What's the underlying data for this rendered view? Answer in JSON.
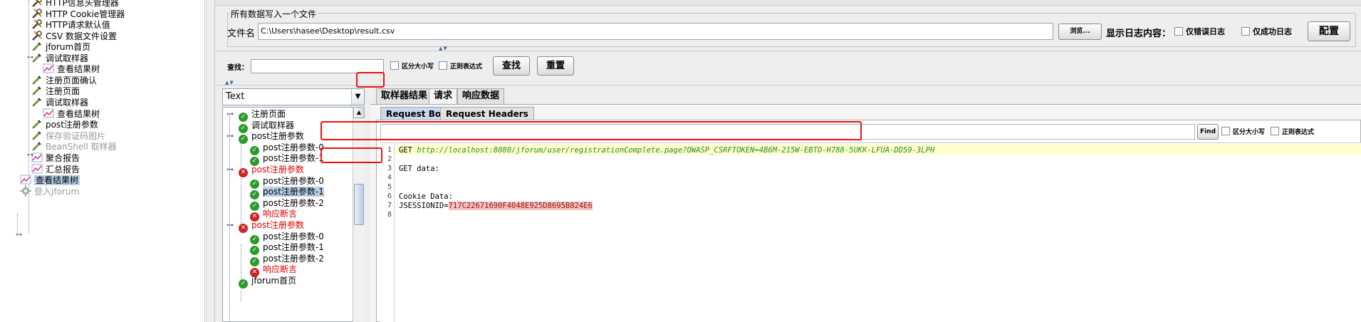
{
  "left_tree": {
    "items": [
      {
        "label": "HTTP信息头管理器",
        "icon": "wrench-icon",
        "disabled": false,
        "selected": false
      },
      {
        "label": "HTTP Cookie管理器",
        "icon": "wrench-icon",
        "disabled": false,
        "selected": false
      },
      {
        "label": "HTTP请求默认值",
        "icon": "wrench-icon",
        "disabled": false,
        "selected": false
      },
      {
        "label": "CSV 数据文件设置",
        "icon": "wrench-icon",
        "disabled": false,
        "selected": false
      },
      {
        "label": "jforum首页",
        "icon": "pipette-icon",
        "disabled": false,
        "selected": false
      },
      {
        "label": "调试取样器",
        "icon": "pipette-icon",
        "disabled": false,
        "selected": false
      },
      {
        "label": "查看结果树",
        "icon": "graph-icon",
        "disabled": false,
        "selected": false
      },
      {
        "label": "注册页面确认",
        "icon": "pipette-icon",
        "disabled": false,
        "selected": false
      },
      {
        "label": "注册页面",
        "icon": "pipette-icon",
        "disabled": false,
        "selected": false
      },
      {
        "label": "调试取样器",
        "icon": "pipette-icon",
        "disabled": false,
        "selected": false
      },
      {
        "label": "查看结果树",
        "icon": "graph-icon",
        "disabled": false,
        "selected": false
      },
      {
        "label": "post注册参数",
        "icon": "pipette-icon",
        "disabled": false,
        "selected": false
      },
      {
        "label": "保存验证码图片",
        "icon": "pipette-icon",
        "disabled": true,
        "selected": false
      },
      {
        "label": "BeanShell 取样器",
        "icon": "pipette-icon",
        "disabled": true,
        "selected": false
      },
      {
        "label": "聚合报告",
        "icon": "graph-icon",
        "disabled": false,
        "selected": false
      },
      {
        "label": "汇总报告",
        "icon": "graph-icon",
        "disabled": false,
        "selected": false
      },
      {
        "label": "查看结果树",
        "icon": "graph-icon",
        "disabled": false,
        "selected": true
      },
      {
        "label": "登入jforum",
        "icon": "gear-icon",
        "disabled": true,
        "selected": false
      }
    ]
  },
  "file_section": {
    "legend": "所有数据写入一个文件",
    "filename_label": "文件名",
    "filename_value": "C:\\Users\\hasee\\Desktop\\result.csv",
    "browse_button": "浏览...",
    "log_label": "显示日志内容：",
    "errors_only": "仅错误日志",
    "success_only": "仅成功日志",
    "configure_button": "配置"
  },
  "search": {
    "label": "查找：",
    "value": "",
    "case_sensitive": "区分大小写",
    "regex": "正则表达式",
    "find_button": "查找",
    "reset_button": "重置"
  },
  "renderer": {
    "selected": "Text"
  },
  "results_tree": {
    "items": [
      {
        "label": "注册页面",
        "status": "ok",
        "level": 0,
        "expander": true
      },
      {
        "label": "调试取样器",
        "status": "ok",
        "level": 0,
        "expander": false
      },
      {
        "label": "post注册参数",
        "status": "ok",
        "level": 0,
        "expander": true
      },
      {
        "label": "post注册参数-0",
        "status": "ok",
        "level": 1,
        "expander": false
      },
      {
        "label": "post注册参数-1",
        "status": "ok",
        "level": 1,
        "expander": false
      },
      {
        "label": "post注册参数",
        "status": "err",
        "level": 0,
        "expander": true
      },
      {
        "label": "post注册参数-0",
        "status": "ok",
        "level": 1,
        "expander": false
      },
      {
        "label": "post注册参数-1",
        "status": "ok",
        "level": 1,
        "expander": false,
        "selected": true
      },
      {
        "label": "post注册参数-2",
        "status": "ok",
        "level": 1,
        "expander": false
      },
      {
        "label": "响应断言",
        "status": "err",
        "level": 1,
        "expander": false
      },
      {
        "label": "post注册参数",
        "status": "err",
        "level": 0,
        "expander": true
      },
      {
        "label": "post注册参数-0",
        "status": "ok",
        "level": 1,
        "expander": false
      },
      {
        "label": "post注册参数-1",
        "status": "ok",
        "level": 1,
        "expander": false
      },
      {
        "label": "post注册参数-2",
        "status": "ok",
        "level": 1,
        "expander": false
      },
      {
        "label": "响应断言",
        "status": "err",
        "level": 1,
        "expander": false
      },
      {
        "label": "jforum首页",
        "status": "ok",
        "level": 0,
        "expander": false
      }
    ]
  },
  "tabs": {
    "sampler_result": "取样器结果",
    "request": "请求",
    "response_data": "响应数据",
    "active": "request"
  },
  "sub_tabs": {
    "request_body": "Request Body",
    "request_headers": "Request Headers",
    "active": "request_body"
  },
  "body_search": {
    "find_button": "Find",
    "case_sensitive": "区分大小写",
    "regex": "正则表达式"
  },
  "request_body": {
    "lines": [
      {
        "num": "1",
        "prefix": "GET ",
        "url": "http://localhost:8080/jforum/user/registrationComplete.page?OWASP_CSRFTOKEN=4B6M-215W-EBTO-H788-5UKK-LFUA-DD59-3LPH",
        "highlight": true
      },
      {
        "num": "2",
        "text": ""
      },
      {
        "num": "3",
        "text": "GET data:"
      },
      {
        "num": "4",
        "text": ""
      },
      {
        "num": "5",
        "text": ""
      },
      {
        "num": "6",
        "text": "Cookie Data:"
      },
      {
        "num": "7",
        "prefix": "JSESSIONID=",
        "session": "717C22671690F4048E925D8695B824E6"
      },
      {
        "num": "8",
        "text": ""
      }
    ]
  },
  "colors": {
    "error": "#ee1111",
    "ok": "#2b9a2b",
    "annotation": "#ee1111"
  }
}
